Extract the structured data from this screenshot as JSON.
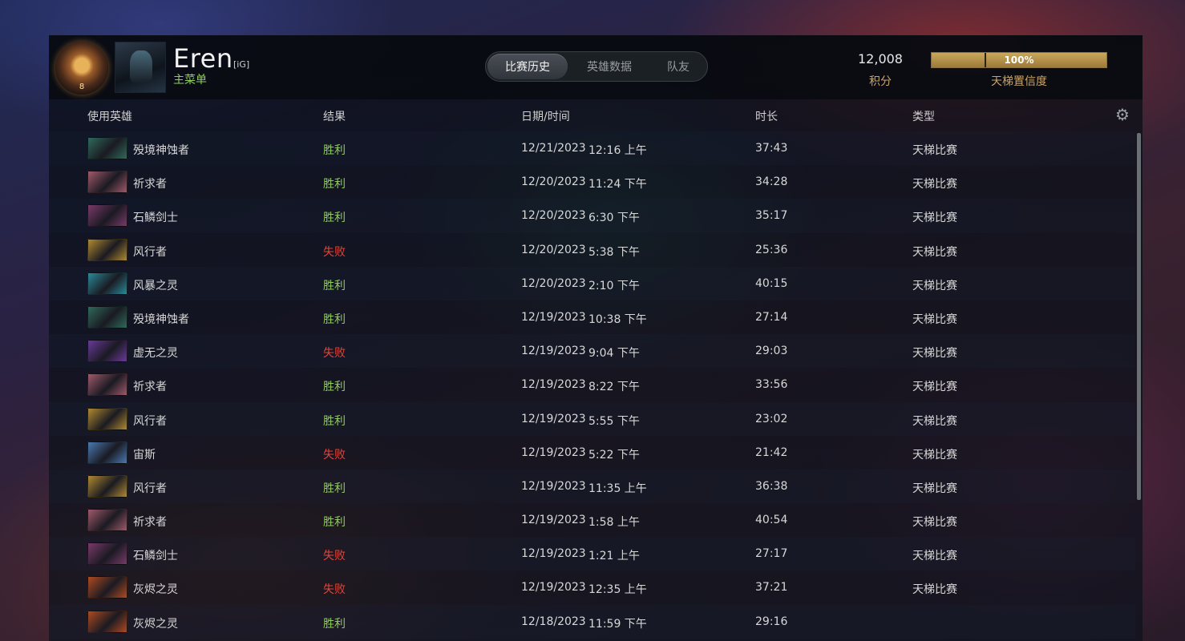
{
  "player": {
    "rank_level": "8",
    "name": "Eren",
    "team_tag": "[iG]",
    "sub_label": "主菜单"
  },
  "tabs": [
    {
      "label": "比赛历史",
      "active": true
    },
    {
      "label": "英雄数据",
      "active": false
    },
    {
      "label": "队友",
      "active": false
    }
  ],
  "stats": {
    "score_value": "12,008",
    "score_label": "积分",
    "confidence_pct": "100%",
    "confidence_fraction": 1.0,
    "confidence_label": "天梯置信度"
  },
  "columns": {
    "hero": "使用英雄",
    "result": "结果",
    "datetime": "日期/时间",
    "duration": "时长",
    "type": "类型"
  },
  "matches": [
    {
      "hero": "殁境神蚀者",
      "result": "胜利",
      "win": true,
      "date": "12/21/2023",
      "time": "12:16 上午",
      "duration": "37:43",
      "type": "天梯比赛",
      "thumb": "#2f6a5a"
    },
    {
      "hero": "祈求者",
      "result": "胜利",
      "win": true,
      "date": "12/20/2023",
      "time": "11:24 下午",
      "duration": "34:28",
      "type": "天梯比赛",
      "thumb": "#a05a6a"
    },
    {
      "hero": "石鳞剑士",
      "result": "胜利",
      "win": true,
      "date": "12/20/2023",
      "time": "6:30 下午",
      "duration": "35:17",
      "type": "天梯比赛",
      "thumb": "#7a3a6a"
    },
    {
      "hero": "风行者",
      "result": "失败",
      "win": false,
      "date": "12/20/2023",
      "time": "5:38 下午",
      "duration": "25:36",
      "type": "天梯比赛",
      "thumb": "#b08a30"
    },
    {
      "hero": "风暴之灵",
      "result": "胜利",
      "win": true,
      "date": "12/20/2023",
      "time": "2:10 下午",
      "duration": "40:15",
      "type": "天梯比赛",
      "thumb": "#2a8a9a"
    },
    {
      "hero": "殁境神蚀者",
      "result": "胜利",
      "win": true,
      "date": "12/19/2023",
      "time": "10:38 下午",
      "duration": "27:14",
      "type": "天梯比赛",
      "thumb": "#2f6a5a"
    },
    {
      "hero": "虚无之灵",
      "result": "失败",
      "win": false,
      "date": "12/19/2023",
      "time": "9:04 下午",
      "duration": "29:03",
      "type": "天梯比赛",
      "thumb": "#6a3a9a"
    },
    {
      "hero": "祈求者",
      "result": "胜利",
      "win": true,
      "date": "12/19/2023",
      "time": "8:22 下午",
      "duration": "33:56",
      "type": "天梯比赛",
      "thumb": "#a05a6a"
    },
    {
      "hero": "风行者",
      "result": "胜利",
      "win": true,
      "date": "12/19/2023",
      "time": "5:55 下午",
      "duration": "23:02",
      "type": "天梯比赛",
      "thumb": "#b08a30"
    },
    {
      "hero": "宙斯",
      "result": "失败",
      "win": false,
      "date": "12/19/2023",
      "time": "5:22 下午",
      "duration": "21:42",
      "type": "天梯比赛",
      "thumb": "#4a7ab0"
    },
    {
      "hero": "风行者",
      "result": "胜利",
      "win": true,
      "date": "12/19/2023",
      "time": "11:35 上午",
      "duration": "36:38",
      "type": "天梯比赛",
      "thumb": "#b08a30"
    },
    {
      "hero": "祈求者",
      "result": "胜利",
      "win": true,
      "date": "12/19/2023",
      "time": "1:58 上午",
      "duration": "40:54",
      "type": "天梯比赛",
      "thumb": "#a05a6a"
    },
    {
      "hero": "石鳞剑士",
      "result": "失败",
      "win": false,
      "date": "12/19/2023",
      "time": "1:21 上午",
      "duration": "27:17",
      "type": "天梯比赛",
      "thumb": "#7a3a6a"
    },
    {
      "hero": "灰烬之灵",
      "result": "失败",
      "win": false,
      "date": "12/19/2023",
      "time": "12:35 上午",
      "duration": "37:21",
      "type": "天梯比赛",
      "thumb": "#b04a20"
    },
    {
      "hero": "灰烬之灵",
      "result": "胜利",
      "win": true,
      "date": "12/18/2023",
      "time": "11:59 下午",
      "duration": "29:16",
      "type": "",
      "thumb": "#b04a20"
    }
  ]
}
